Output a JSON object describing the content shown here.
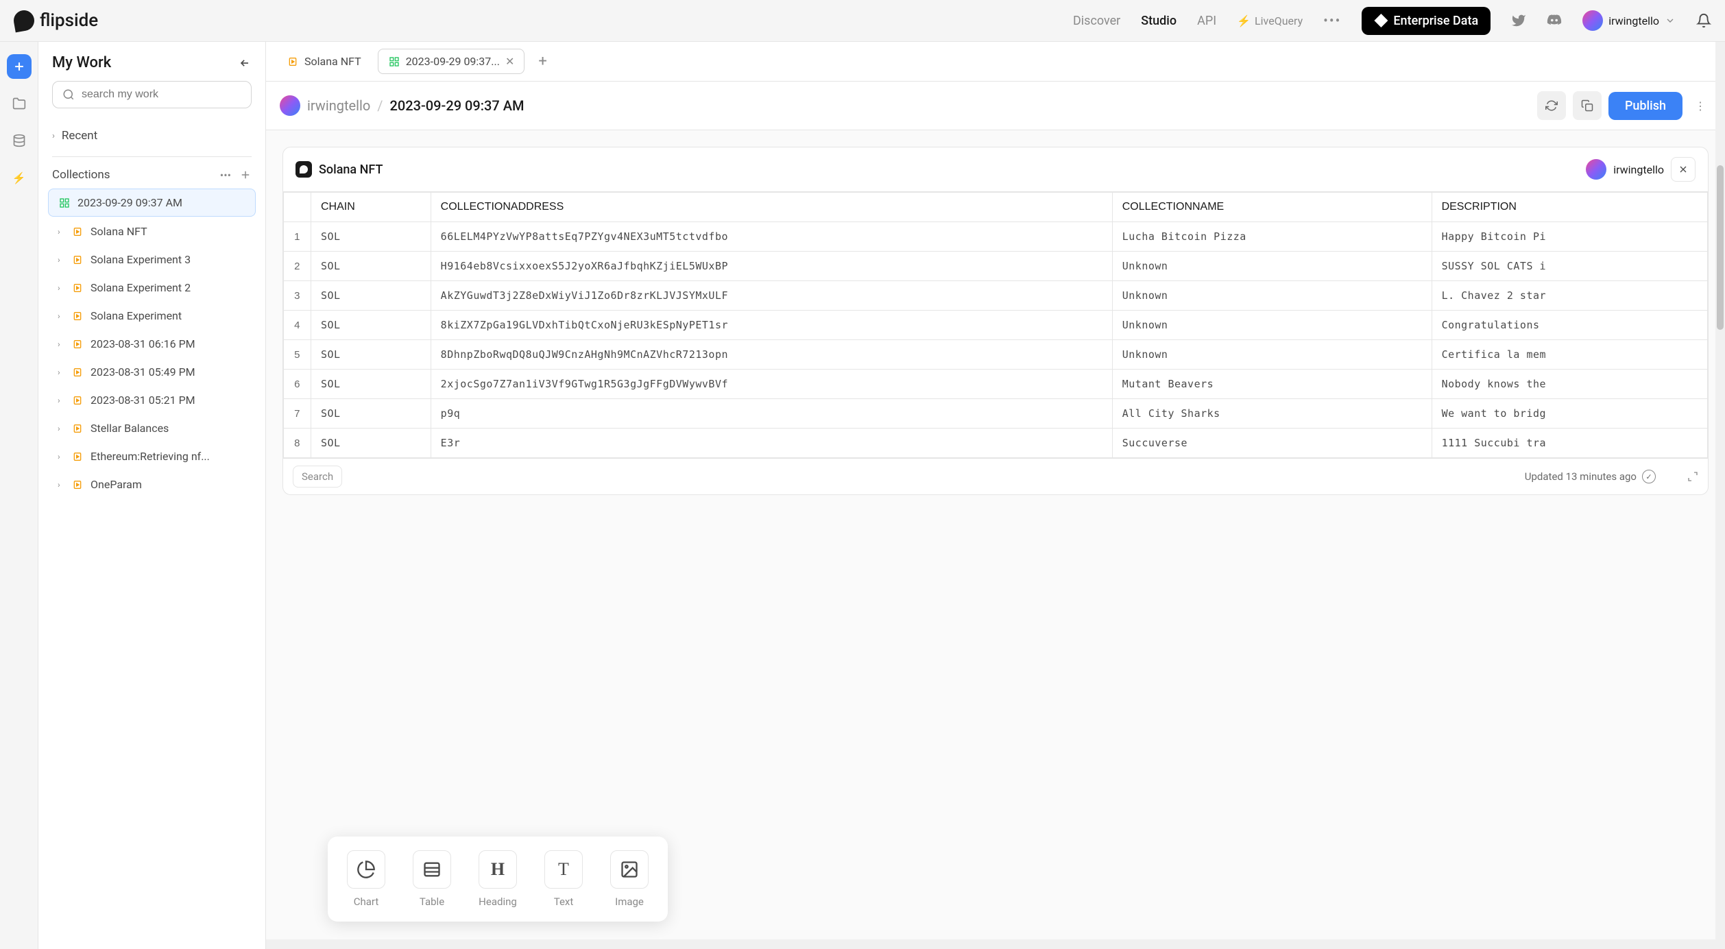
{
  "brand": "flipside",
  "nav": {
    "discover": "Discover",
    "studio": "Studio",
    "api": "API",
    "livequery": "LiveQuery",
    "enterprise": "Enterprise Data"
  },
  "user": "irwingtello",
  "sidebar": {
    "title": "My Work",
    "search_placeholder": "search my work",
    "recent": "Recent",
    "collections_label": "Collections",
    "items": [
      {
        "label": "2023-09-29 09:37 AM",
        "type": "dash",
        "selected": true
      },
      {
        "label": "Solana NFT",
        "type": "file"
      },
      {
        "label": "Solana Experiment 3",
        "type": "file"
      },
      {
        "label": "Solana Experiment 2",
        "type": "file"
      },
      {
        "label": "Solana Experiment",
        "type": "file"
      },
      {
        "label": "2023-08-31 06:16 PM",
        "type": "file"
      },
      {
        "label": "2023-08-31 05:49 PM",
        "type": "file"
      },
      {
        "label": "2023-08-31 05:21 PM",
        "type": "file"
      },
      {
        "label": "Stellar Balances",
        "type": "file"
      },
      {
        "label": "Ethereum:Retrieving nf...",
        "type": "file"
      },
      {
        "label": "OneParam",
        "type": "file"
      }
    ]
  },
  "tabs": [
    {
      "label": "Solana NFT",
      "icon": "file",
      "active": false,
      "closable": false
    },
    {
      "label": "2023-09-29 09:37...",
      "icon": "dash",
      "active": true,
      "closable": true
    }
  ],
  "breadcrumb": {
    "user": "irwingtello",
    "title": "2023-09-29 09:37 AM",
    "publish": "Publish"
  },
  "panel": {
    "title": "Solana NFT",
    "user": "irwingtello",
    "search": "Search",
    "updated": "Updated 13 minutes ago",
    "columns": [
      "CHAIN",
      "COLLECTIONADDRESS",
      "COLLECTIONNAME",
      "DESCRIPTION"
    ],
    "rows": [
      [
        "SOL",
        "66LELM4PYzVwYP8attsEq7PZYgv4NEX3uMT5tctvdfbo",
        "Lucha Bitcoin Pizza",
        "Happy Bitcoin Pi"
      ],
      [
        "SOL",
        "H9164eb8VcsixxoexS5J2yoXR6aJfbqhKZjiEL5WUxBP",
        "Unknown",
        "SUSSY SOL CATS i"
      ],
      [
        "SOL",
        "AkZYGuwdT3j2Z8eDxWiyViJ1Zo6Dr8zrKLJVJSYMxULF",
        "Unknown",
        "L. Chavez 2 star"
      ],
      [
        "SOL",
        "8kiZX7ZpGa19GLVDxhTibQtCxoNjeRU3kESpNyPET1sr",
        "Unknown",
        "Congratulations"
      ],
      [
        "SOL",
        "8DhnpZboRwqDQ8uQJW9CnzAHgNh9MCnAZVhcR7213opn",
        "Unknown",
        "Certifica la mem"
      ],
      [
        "SOL",
        "2xjocSgo7Z7an1iV3Vf9GTwg1R5G3gJgFFgDVWywvBVf",
        "Mutant Beavers",
        "Nobody knows the"
      ],
      [
        "SOL",
        "p9q",
        "All City Sharks",
        "We want to bridg"
      ],
      [
        "SOL",
        "E3r",
        "Succuverse",
        "1111 Succubi tra"
      ]
    ]
  },
  "toolbar": {
    "chart": "Chart",
    "table": "Table",
    "heading": "Heading",
    "text": "Text",
    "image": "Image"
  }
}
